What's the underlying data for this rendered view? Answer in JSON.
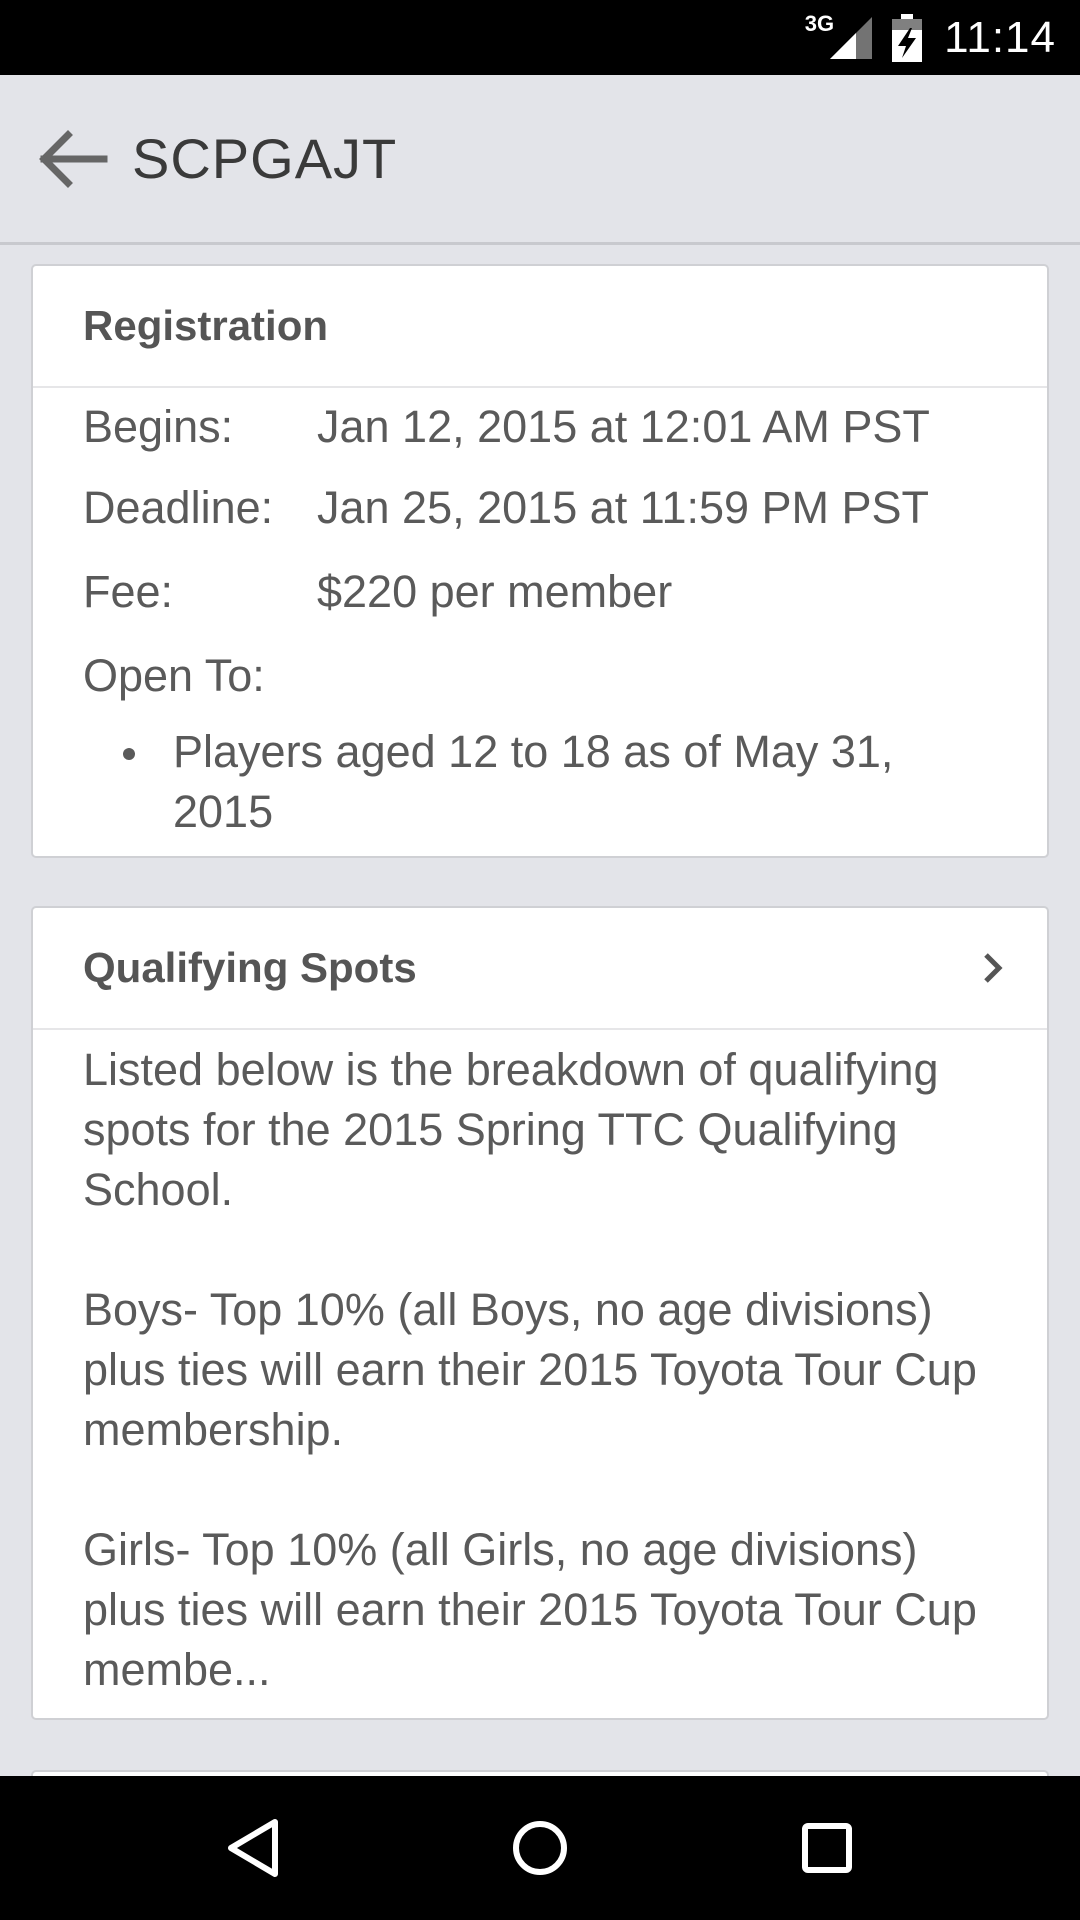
{
  "status_bar": {
    "network": "3G",
    "time": "11:14",
    "icons": [
      "signal-icon",
      "battery-charging-icon"
    ]
  },
  "app_bar": {
    "title": "SCPGAJT",
    "back_icon": "arrow-back-icon"
  },
  "registration": {
    "title": "Registration",
    "rows": [
      {
        "label": "Begins:",
        "value": "Jan 12, 2015 at 12:01 AM PST"
      },
      {
        "label": "Deadline:",
        "value": "Jan 25, 2015 at 11:59 PM PST"
      },
      {
        "label": "Fee:",
        "value": "$220 per member"
      }
    ],
    "open_to_label": "Open To:",
    "open_to_items": [
      "Players aged 12 to 18 as of May 31, 2015"
    ]
  },
  "qualifying": {
    "title": "Qualifying Spots",
    "chevron_icon": "chevron-right-icon",
    "paragraphs": [
      "Listed below is the breakdown of qualifying spots for the 2015 Spring TTC Qualifying School.",
      "Boys- Top 10% (all Boys, no age divisions) plus ties will earn their 2015 Toyota Tour Cup membership.",
      "Girls- Top 10% (all Girls, no age divisions) plus ties will earn their 2015 Toyota Tour Cup membe..."
    ]
  },
  "nav_bar": {
    "icons": [
      "nav-back-icon",
      "nav-home-icon",
      "nav-recents-icon"
    ]
  }
}
